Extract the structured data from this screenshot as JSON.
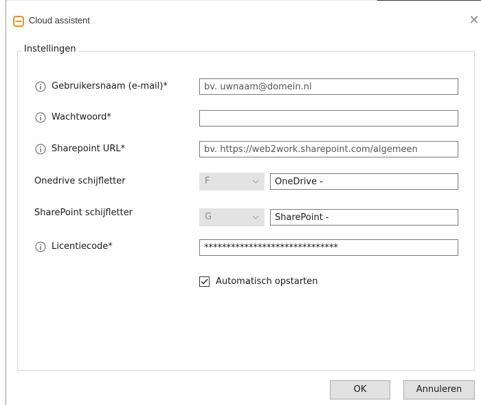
{
  "window": {
    "title": "Cloud assistent",
    "close_glyph": "✕",
    "app_icon": "cloud-assistent-logo-icon",
    "accent_color": "#f39200"
  },
  "settings": {
    "group_title": "Instellingen",
    "username": {
      "label": "Gebruikersnaam (e-mail)*",
      "value": "",
      "placeholder": "bv. uwnaam@domein.nl",
      "icon": "info-icon"
    },
    "password": {
      "label": "Wachtwoord*",
      "value": "",
      "placeholder": "",
      "icon": "info-icon"
    },
    "sharepoint_url": {
      "label": "Sharepoint URL*",
      "value": "",
      "placeholder": "bv. https://web2work.sharepoint.com/algemeen",
      "icon": "info-icon"
    },
    "onedrive_drive": {
      "label": "Onedrive schijfletter",
      "letter": "F",
      "name": "OneDrive -"
    },
    "sharepoint_drive": {
      "label": "SharePoint schijfletter",
      "letter": "G",
      "name": "SharePoint -"
    },
    "license": {
      "label": "Licentiecode*",
      "value": "******************************",
      "icon": "info-icon"
    },
    "autostart": {
      "label": "Automatisch opstarten",
      "checked": true
    }
  },
  "buttons": {
    "ok": "OK",
    "cancel": "Annuleren"
  }
}
